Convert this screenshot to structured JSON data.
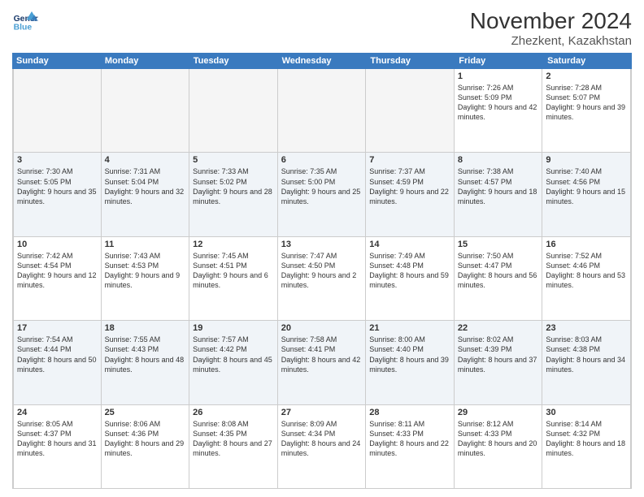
{
  "logo": {
    "line1": "General",
    "line2": "Blue"
  },
  "title": "November 2024",
  "subtitle": "Zhezkent, Kazakhstan",
  "days": [
    "Sunday",
    "Monday",
    "Tuesday",
    "Wednesday",
    "Thursday",
    "Friday",
    "Saturday"
  ],
  "rows": [
    [
      {
        "day": "",
        "info": "",
        "empty": true
      },
      {
        "day": "",
        "info": "",
        "empty": true
      },
      {
        "day": "",
        "info": "",
        "empty": true
      },
      {
        "day": "",
        "info": "",
        "empty": true
      },
      {
        "day": "",
        "info": "",
        "empty": true
      },
      {
        "day": "1",
        "info": "Sunrise: 7:26 AM\nSunset: 5:09 PM\nDaylight: 9 hours and 42 minutes."
      },
      {
        "day": "2",
        "info": "Sunrise: 7:28 AM\nSunset: 5:07 PM\nDaylight: 9 hours and 39 minutes."
      }
    ],
    [
      {
        "day": "3",
        "info": "Sunrise: 7:30 AM\nSunset: 5:05 PM\nDaylight: 9 hours and 35 minutes."
      },
      {
        "day": "4",
        "info": "Sunrise: 7:31 AM\nSunset: 5:04 PM\nDaylight: 9 hours and 32 minutes."
      },
      {
        "day": "5",
        "info": "Sunrise: 7:33 AM\nSunset: 5:02 PM\nDaylight: 9 hours and 28 minutes."
      },
      {
        "day": "6",
        "info": "Sunrise: 7:35 AM\nSunset: 5:00 PM\nDaylight: 9 hours and 25 minutes."
      },
      {
        "day": "7",
        "info": "Sunrise: 7:37 AM\nSunset: 4:59 PM\nDaylight: 9 hours and 22 minutes."
      },
      {
        "day": "8",
        "info": "Sunrise: 7:38 AM\nSunset: 4:57 PM\nDaylight: 9 hours and 18 minutes."
      },
      {
        "day": "9",
        "info": "Sunrise: 7:40 AM\nSunset: 4:56 PM\nDaylight: 9 hours and 15 minutes."
      }
    ],
    [
      {
        "day": "10",
        "info": "Sunrise: 7:42 AM\nSunset: 4:54 PM\nDaylight: 9 hours and 12 minutes."
      },
      {
        "day": "11",
        "info": "Sunrise: 7:43 AM\nSunset: 4:53 PM\nDaylight: 9 hours and 9 minutes."
      },
      {
        "day": "12",
        "info": "Sunrise: 7:45 AM\nSunset: 4:51 PM\nDaylight: 9 hours and 6 minutes."
      },
      {
        "day": "13",
        "info": "Sunrise: 7:47 AM\nSunset: 4:50 PM\nDaylight: 9 hours and 2 minutes."
      },
      {
        "day": "14",
        "info": "Sunrise: 7:49 AM\nSunset: 4:48 PM\nDaylight: 8 hours and 59 minutes."
      },
      {
        "day": "15",
        "info": "Sunrise: 7:50 AM\nSunset: 4:47 PM\nDaylight: 8 hours and 56 minutes."
      },
      {
        "day": "16",
        "info": "Sunrise: 7:52 AM\nSunset: 4:46 PM\nDaylight: 8 hours and 53 minutes."
      }
    ],
    [
      {
        "day": "17",
        "info": "Sunrise: 7:54 AM\nSunset: 4:44 PM\nDaylight: 8 hours and 50 minutes."
      },
      {
        "day": "18",
        "info": "Sunrise: 7:55 AM\nSunset: 4:43 PM\nDaylight: 8 hours and 48 minutes."
      },
      {
        "day": "19",
        "info": "Sunrise: 7:57 AM\nSunset: 4:42 PM\nDaylight: 8 hours and 45 minutes."
      },
      {
        "day": "20",
        "info": "Sunrise: 7:58 AM\nSunset: 4:41 PM\nDaylight: 8 hours and 42 minutes."
      },
      {
        "day": "21",
        "info": "Sunrise: 8:00 AM\nSunset: 4:40 PM\nDaylight: 8 hours and 39 minutes."
      },
      {
        "day": "22",
        "info": "Sunrise: 8:02 AM\nSunset: 4:39 PM\nDaylight: 8 hours and 37 minutes."
      },
      {
        "day": "23",
        "info": "Sunrise: 8:03 AM\nSunset: 4:38 PM\nDaylight: 8 hours and 34 minutes."
      }
    ],
    [
      {
        "day": "24",
        "info": "Sunrise: 8:05 AM\nSunset: 4:37 PM\nDaylight: 8 hours and 31 minutes."
      },
      {
        "day": "25",
        "info": "Sunrise: 8:06 AM\nSunset: 4:36 PM\nDaylight: 8 hours and 29 minutes."
      },
      {
        "day": "26",
        "info": "Sunrise: 8:08 AM\nSunset: 4:35 PM\nDaylight: 8 hours and 27 minutes."
      },
      {
        "day": "27",
        "info": "Sunrise: 8:09 AM\nSunset: 4:34 PM\nDaylight: 8 hours and 24 minutes."
      },
      {
        "day": "28",
        "info": "Sunrise: 8:11 AM\nSunset: 4:33 PM\nDaylight: 8 hours and 22 minutes."
      },
      {
        "day": "29",
        "info": "Sunrise: 8:12 AM\nSunset: 4:33 PM\nDaylight: 8 hours and 20 minutes."
      },
      {
        "day": "30",
        "info": "Sunrise: 8:14 AM\nSunset: 4:32 PM\nDaylight: 8 hours and 18 minutes."
      }
    ]
  ]
}
